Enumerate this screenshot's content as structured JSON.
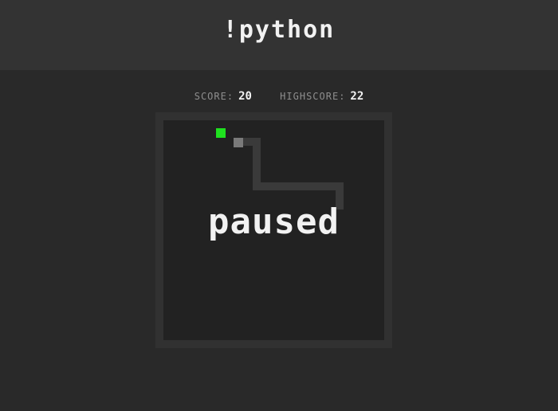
{
  "app": {
    "title": "!python"
  },
  "scores": {
    "score_label": "SCORE:",
    "score_value": "20",
    "highscore_label": "HIGHSCORE:",
    "highscore_value": "22"
  },
  "game": {
    "status_text": "paused"
  },
  "colors": {
    "page_background": "#292929",
    "header_background": "#333333",
    "board_border": "#313131",
    "board_background": "#222222",
    "apple": "#1fe11f",
    "snake_head": "#7a7a7a",
    "snake_body": "#3a3a3a",
    "text": "#f2f2f2",
    "label_text": "#8e8e8e"
  }
}
